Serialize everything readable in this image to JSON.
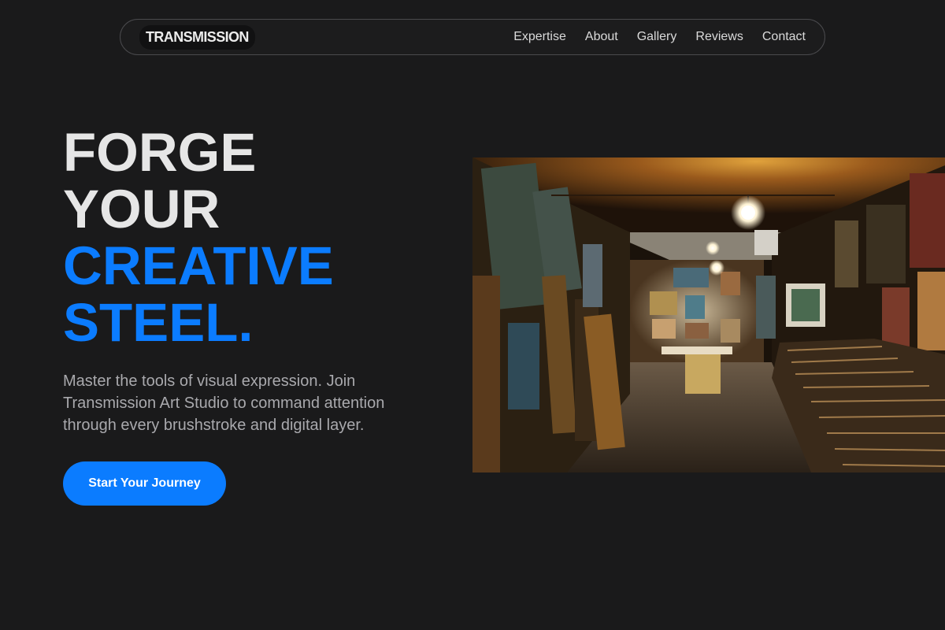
{
  "nav": {
    "brand": "TRANSMISSION",
    "links": [
      "Expertise",
      "About",
      "Gallery",
      "Reviews",
      "Contact"
    ]
  },
  "hero": {
    "title_lines": [
      "FORGE",
      "YOUR",
      "CREATIVE",
      "STEEL."
    ],
    "subtitle": "Master the tools of visual expression. Join Transmission Art Studio to command attention through every brushstroke and digital layer.",
    "cta_label": "Start Your Journey"
  },
  "colors": {
    "background": "#1a1a1b",
    "accent": "#0b7cff",
    "text": "#e6e6e6",
    "muted": "#a9a9ad"
  }
}
